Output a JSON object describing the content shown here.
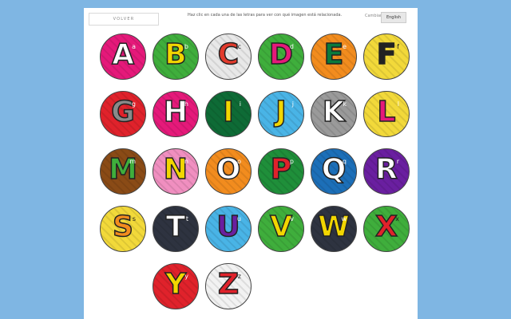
{
  "header": {
    "back_label": "VOLVER",
    "instruction": "Haz clic en cada una de las letras para ver con qué imagen está relacionada.",
    "language_label": "Cambiar",
    "language_button": "English"
  },
  "letters": [
    {
      "upper": "A",
      "lower": "a",
      "bg": "#e5197a",
      "fg": "#ffffff",
      "lowerColor": "#ffffff"
    },
    {
      "upper": "B",
      "lower": "b",
      "bg": "#3fae3c",
      "fg": "#f2d600",
      "lowerColor": "#ffffff"
    },
    {
      "upper": "C",
      "lower": "c",
      "bg": "#e8e8e8",
      "fg": "#e23b2c",
      "lowerColor": "#222222"
    },
    {
      "upper": "D",
      "lower": "d",
      "bg": "#3fae3c",
      "fg": "#e5197a",
      "lowerColor": "#ffffff"
    },
    {
      "upper": "E",
      "lower": "e",
      "bg": "#f28c1e",
      "fg": "#0a7a3c",
      "lowerColor": "#ffffff"
    },
    {
      "upper": "F",
      "lower": "f",
      "bg": "#f2d93a",
      "fg": "#222222",
      "lowerColor": "#222222"
    },
    {
      "upper": "G",
      "lower": "g",
      "bg": "#e0222b",
      "fg": "#8a8a8a",
      "lowerColor": "#ffffff"
    },
    {
      "upper": "H",
      "lower": "h",
      "bg": "#e5197a",
      "fg": "#ffffff",
      "lowerColor": "#ffffff"
    },
    {
      "upper": "I",
      "lower": "i",
      "bg": "#0e6b36",
      "fg": "#f2d600",
      "lowerColor": "#ffffff"
    },
    {
      "upper": "J",
      "lower": "j",
      "bg": "#49b4e6",
      "fg": "#f2d600",
      "lowerColor": "#ffffff"
    },
    {
      "upper": "K",
      "lower": "k",
      "bg": "#9a9a9a",
      "fg": "#ffffff",
      "lowerColor": "#ffffff"
    },
    {
      "upper": "L",
      "lower": "l",
      "bg": "#f2d93a",
      "fg": "#e5197a",
      "lowerColor": "#ffffff"
    },
    {
      "upper": "M",
      "lower": "m",
      "bg": "#8a4b16",
      "fg": "#3fae3c",
      "lowerColor": "#ffffff"
    },
    {
      "upper": "N",
      "lower": "n",
      "bg": "#f08fc0",
      "fg": "#f2d600",
      "lowerColor": "#ffffff"
    },
    {
      "upper": "O",
      "lower": "o",
      "bg": "#f28c1e",
      "fg": "#ffffff",
      "lowerColor": "#ffffff"
    },
    {
      "upper": "P",
      "lower": "p",
      "bg": "#1f8f3a",
      "fg": "#e0222b",
      "lowerColor": "#ffffff"
    },
    {
      "upper": "Q",
      "lower": "q",
      "bg": "#1c6fb8",
      "fg": "#ffffff",
      "lowerColor": "#ffffff"
    },
    {
      "upper": "R",
      "lower": "r",
      "bg": "#6a1fa0",
      "fg": "#ffffff",
      "lowerColor": "#ffffff"
    },
    {
      "upper": "S",
      "lower": "s",
      "bg": "#f2d93a",
      "fg": "#f28c1e",
      "lowerColor": "#222222"
    },
    {
      "upper": "T",
      "lower": "t",
      "bg": "#2e3340",
      "fg": "#ffffff",
      "lowerColor": "#ffffff"
    },
    {
      "upper": "U",
      "lower": "u",
      "bg": "#49b4e6",
      "fg": "#6a1fa0",
      "lowerColor": "#ffffff"
    },
    {
      "upper": "V",
      "lower": "v",
      "bg": "#3fae3c",
      "fg": "#f2d600",
      "lowerColor": "#ffffff"
    },
    {
      "upper": "W",
      "lower": "w",
      "bg": "#2e3340",
      "fg": "#f2d600",
      "lowerColor": "#ffffff"
    },
    {
      "upper": "X",
      "lower": "x",
      "bg": "#3fae3c",
      "fg": "#e0222b",
      "lowerColor": "#222222"
    },
    {
      "upper": "Y",
      "lower": "y",
      "bg": "#e0222b",
      "fg": "#f2d600",
      "lowerColor": "#ffffff"
    },
    {
      "upper": "Z",
      "lower": "z",
      "bg": "#f2f2f2",
      "fg": "#e0222b",
      "lowerColor": "#222222"
    }
  ]
}
